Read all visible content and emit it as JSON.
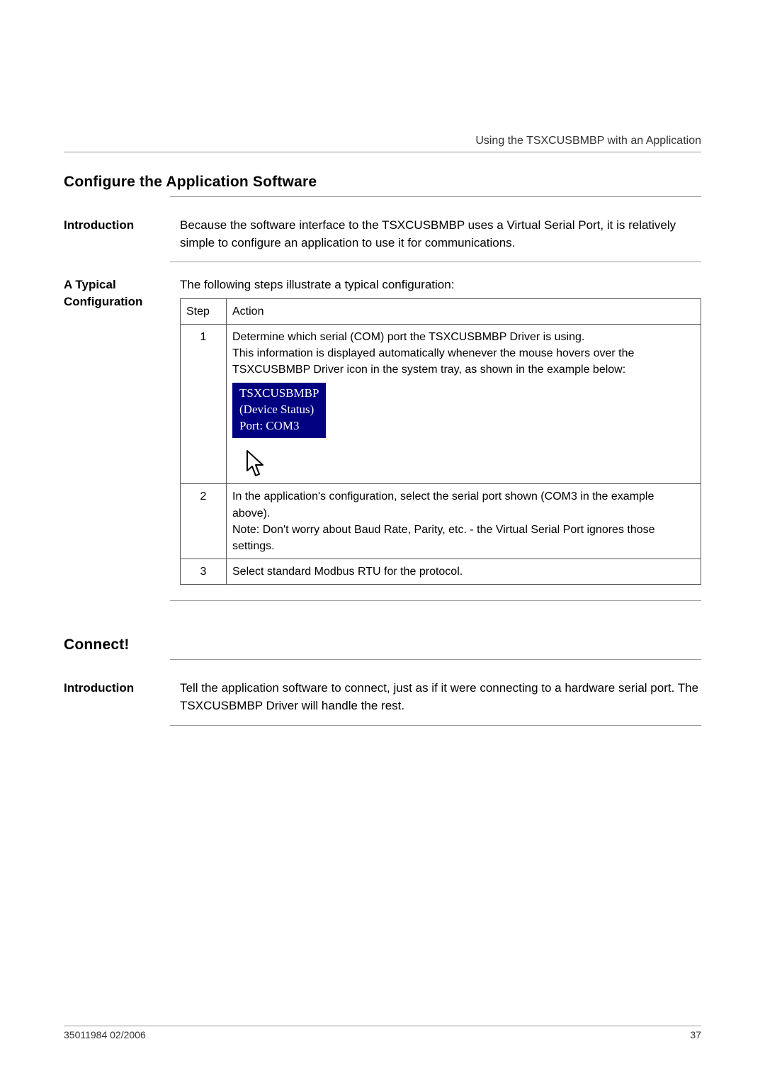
{
  "header": {
    "running_title": "Using the TSXCUSBMBP with an Application"
  },
  "section1": {
    "title": "Configure the Application Software",
    "intro_label": "Introduction",
    "intro_text": "Because the software interface to the TSXCUSBMBP uses a Virtual Serial Port, it is relatively simple to configure an application to use it for communications.",
    "config_label": "A Typical Configuration",
    "config_lead": "The following steps illustrate a typical configuration:",
    "table": {
      "col_step": "Step",
      "col_action": "Action",
      "rows": [
        {
          "num": "1",
          "line1": "Determine which serial (COM) port the TSXCUSBMBP Driver is using.",
          "line2": "This information is displayed automatically whenever the mouse hovers over the TSXCUSBMBP Driver icon in the system tray, as shown in the example below:",
          "tooltip": {
            "l1": "TSXCUSBMBP",
            "l2": "(Device Status)",
            "l3": "Port: COM3"
          }
        },
        {
          "num": "2",
          "line1": "In the application's configuration, select the serial port shown (COM3 in the example above).",
          "line2": "Note: Don't worry about Baud Rate, Parity, etc. - the Virtual Serial Port ignores those settings."
        },
        {
          "num": "3",
          "line1": "Select standard Modbus RTU for the protocol."
        }
      ]
    }
  },
  "section2": {
    "title": "Connect!",
    "intro_label": "Introduction",
    "intro_text": "Tell the application software to connect, just as if it were connecting to a hardware serial port. The TSXCUSBMBP Driver will handle the rest."
  },
  "footer": {
    "doc_id": "35011984 02/2006",
    "page_num": "37"
  }
}
